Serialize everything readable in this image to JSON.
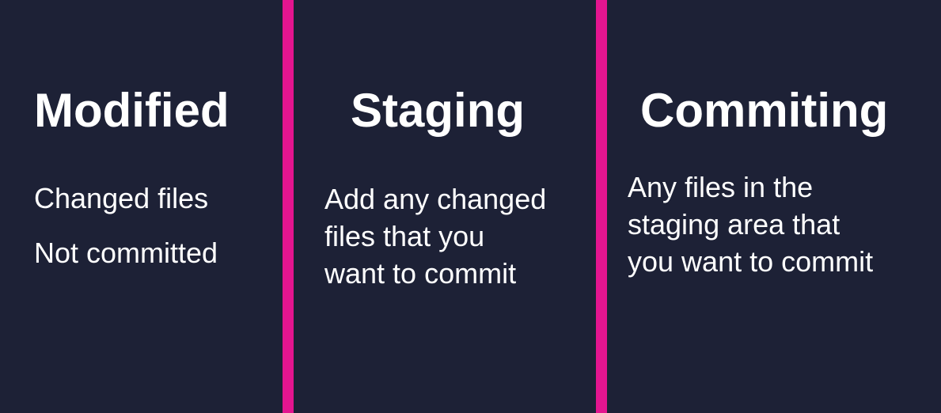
{
  "columns": [
    {
      "title": "Modified",
      "lines": [
        "Changed files",
        "Not committed"
      ]
    },
    {
      "title": "Staging",
      "lines": [
        "Add any changed",
        "files that you",
        "want to commit"
      ]
    },
    {
      "title": "Commiting",
      "lines": [
        "Any files in the",
        "staging area that",
        "you want to commit"
      ]
    }
  ],
  "colors": {
    "background": "#1d2136",
    "divider": "#e3158f",
    "text": "#ffffff"
  }
}
